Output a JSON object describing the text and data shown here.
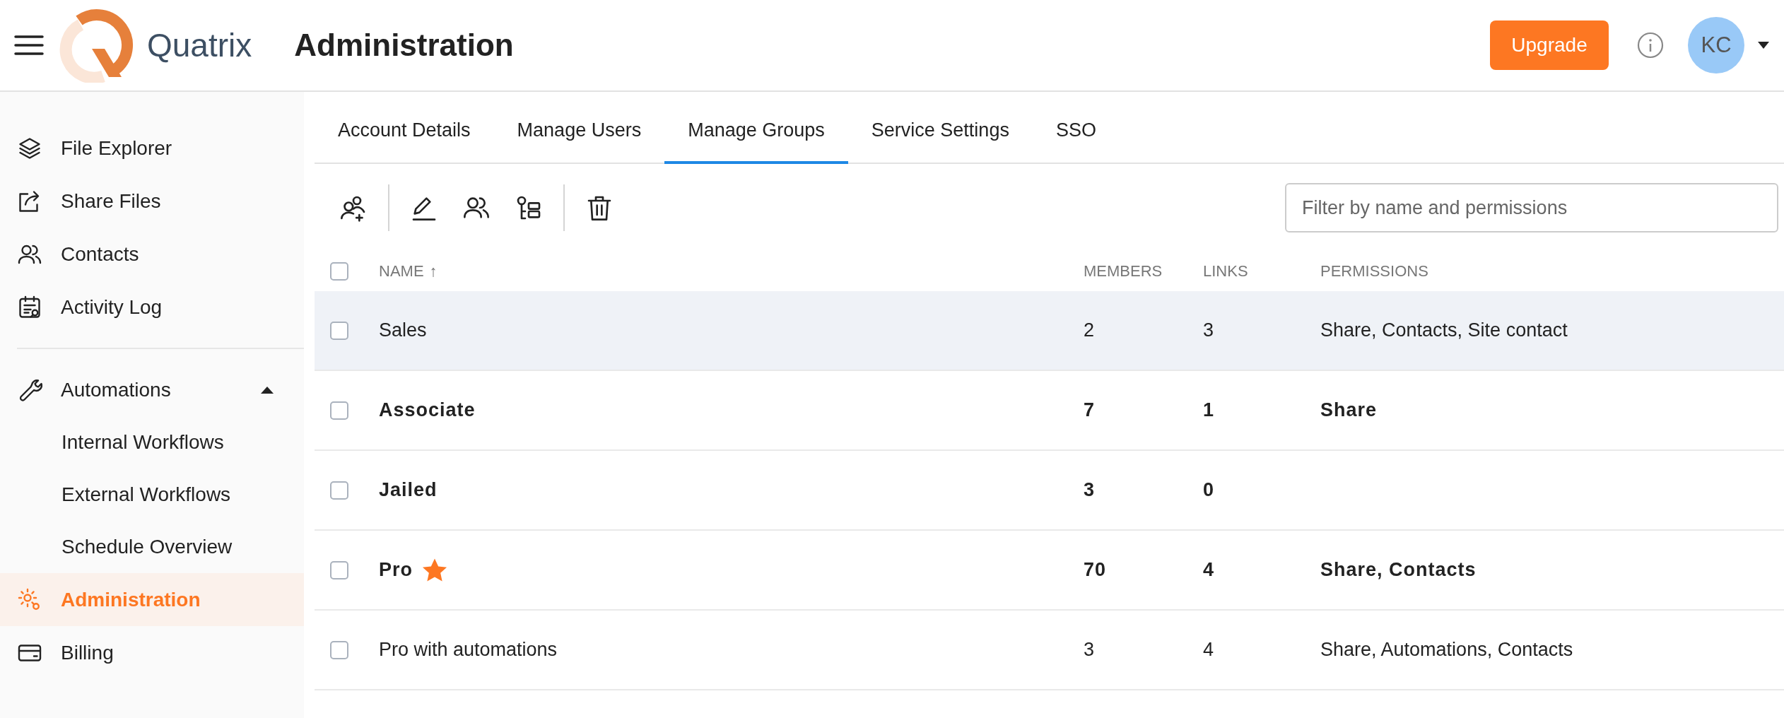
{
  "header": {
    "brand": "Quatrix",
    "title": "Administration",
    "upgrade_button": "Upgrade",
    "avatar": "KC"
  },
  "sidebar": {
    "sections": [
      {
        "items": [
          {
            "label": "File Explorer",
            "selected": false
          },
          {
            "label": "Share Files",
            "selected": false
          },
          {
            "label": "Contacts",
            "selected": false
          },
          {
            "label": "Activity Log",
            "selected": false
          }
        ]
      },
      {
        "items": [
          {
            "label": "Automations",
            "selected": false,
            "expanded": true,
            "children": [
              {
                "label": "Internal Workflows",
                "selected": false
              },
              {
                "label": "External Workflows",
                "selected": false
              },
              {
                "label": "Schedule Overview",
                "selected": false
              }
            ]
          },
          {
            "label": "Administration",
            "selected": true
          },
          {
            "label": "Billing",
            "selected": false
          }
        ]
      }
    ]
  },
  "tabs": [
    {
      "label": "Account Details",
      "selected": false
    },
    {
      "label": "Manage Users",
      "selected": false
    },
    {
      "label": "Manage Groups",
      "selected": true
    },
    {
      "label": "Service Settings",
      "selected": false
    },
    {
      "label": "SSO",
      "selected": false
    }
  ],
  "toolbar": {
    "filter": {
      "placeholder": "Filter by name and permissions"
    }
  },
  "table": {
    "all_checked": false,
    "columns": [
      "NAME",
      "MEMBERS",
      "LINKS",
      "PERMISSIONS"
    ],
    "sort_arrow": "↑",
    "rows": [
      {
        "name": "Sales",
        "members": "2",
        "links": "3",
        "permissions": "Share, Contacts, Site contact",
        "selected": true,
        "checked": false,
        "bold": false,
        "starred": false
      },
      {
        "name": "Associate",
        "members": "7",
        "links": "1",
        "permissions": "Share",
        "selected": false,
        "checked": false,
        "bold": true,
        "starred": false
      },
      {
        "name": "Jailed",
        "members": "3",
        "links": "0",
        "selected": false,
        "checked": false,
        "bold": true,
        "starred": false
      },
      {
        "name": "Pro",
        "members": "70",
        "links": "4",
        "permissions": "Share, Contacts",
        "selected": false,
        "checked": false,
        "bold": true,
        "starred": true
      },
      {
        "name": "Pro with automations",
        "members": "3",
        "links": "4",
        "permissions": "Share, Automations, Contacts",
        "selected": false,
        "checked": false,
        "bold": false,
        "starred": false
      }
    ]
  }
}
